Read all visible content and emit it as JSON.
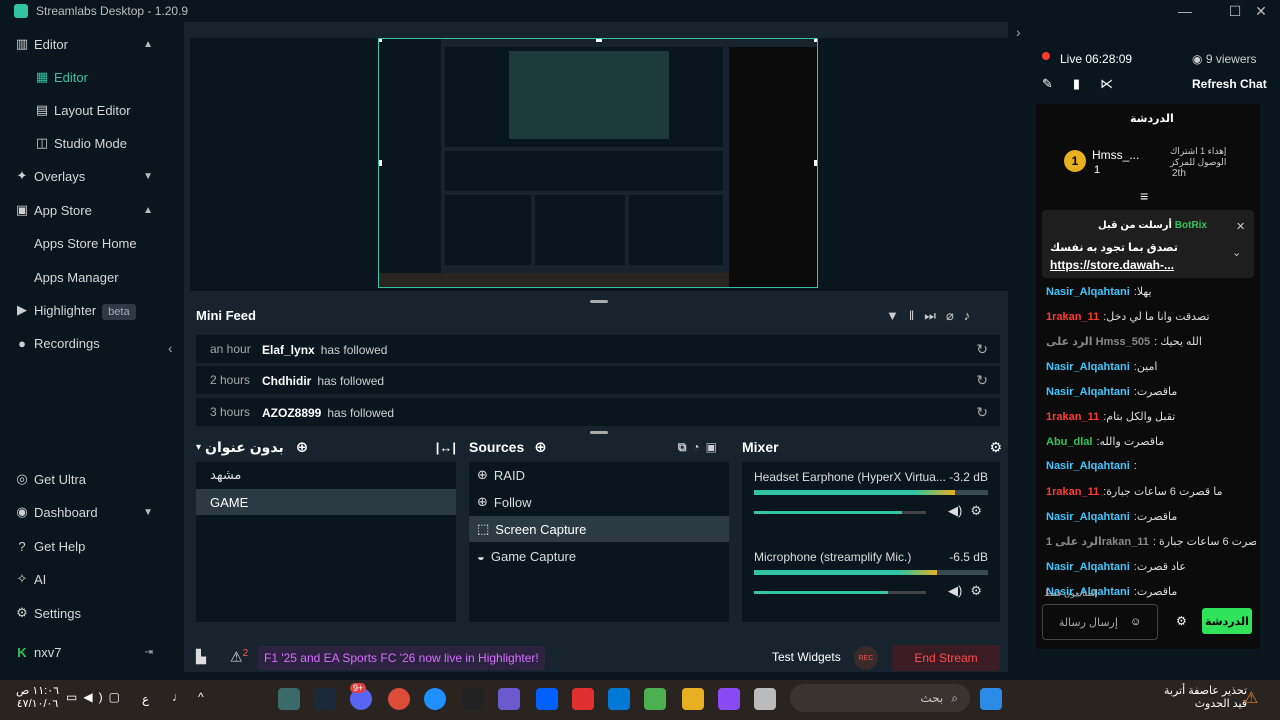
{
  "titlebar": {
    "title": "Streamlabs Desktop - 1.20.9"
  },
  "sidebar": {
    "items": [
      {
        "label": "Editor",
        "icon": "layout-icon",
        "chevron": "▲"
      },
      {
        "label": "Editor",
        "icon": "editor-icon"
      },
      {
        "label": "Layout Editor",
        "icon": "grid-icon"
      },
      {
        "label": "Studio Mode",
        "icon": "studio-icon"
      },
      {
        "label": "Overlays",
        "icon": "overlays-icon",
        "chevron": "▼"
      },
      {
        "label": "App Store",
        "icon": "store-icon",
        "chevron": "▲"
      },
      {
        "label": "Apps Store Home"
      },
      {
        "label": "Apps Manager"
      },
      {
        "label": "Highlighter",
        "icon": "highlighter-icon",
        "badge": "beta"
      },
      {
        "label": "Recordings",
        "icon": "recordings-icon"
      }
    ],
    "bottom": [
      {
        "label": "Get Ultra",
        "icon": "ultra-icon"
      },
      {
        "label": "Dashboard",
        "icon": "dashboard-icon",
        "chevron": "▼"
      },
      {
        "label": "Get Help",
        "icon": "help-icon"
      },
      {
        "label": "AI",
        "icon": "ai-icon"
      },
      {
        "label": "Settings",
        "icon": "gear-icon"
      }
    ],
    "user": "nxv7"
  },
  "minifeed": {
    "title": "Mini Feed",
    "rows": [
      {
        "time": "an hour",
        "who": "Elaf_lynx",
        "action": "has followed"
      },
      {
        "time": "2 hours",
        "who": "Chdhidir",
        "action": "has followed"
      },
      {
        "time": "3 hours",
        "who": "AZOZ8899",
        "action": "has followed"
      }
    ]
  },
  "scenes": {
    "title": "بدون عنوان",
    "items": [
      "مشهد",
      "GAME"
    ]
  },
  "sources": {
    "title": "Sources",
    "items": [
      "RAID",
      "Follow",
      "Screen Capture",
      "Game Capture"
    ]
  },
  "mixer": {
    "title": "Mixer",
    "channels": [
      {
        "name": "Headset Earphone (HyperX Virtua...",
        "db": "-3.2 dB",
        "level": 0.86
      },
      {
        "name": "Microphone (streamplify Mic.)",
        "db": "-6.5 dB",
        "level": 0.78
      }
    ]
  },
  "footer": {
    "alerts": "2",
    "promo": "F1 '25 and EA Sports FC '26 now live in Highlighter!",
    "test_widgets": "Test Widgets",
    "rec": "REC",
    "end_stream": "End Stream"
  },
  "chat": {
    "live": "Live",
    "time": "06:28:09",
    "viewers": "9 viewers",
    "refresh": "Refresh Chat",
    "header": "الدردشة",
    "top_user": "Hmss_...",
    "top_count": "1",
    "gift_text": "إهداء 1 اشتراك الوصول للمركز",
    "gift_rank": "2th",
    "pinned_from": "أرسلت من قبل",
    "pinned_user": "BotRix",
    "pinned_msg": "تصدق بما تجود به نفسك",
    "pinned_link": "https://store.dawah-...",
    "messages": [
      {
        "user": "Nasir_Alqahtani",
        "text": ":يهلا",
        "color": "#41c6ff"
      },
      {
        "user": "1rakan_11",
        "text": ":تصدقت وانا ما لي دخل",
        "color": "#ff3b30"
      },
      {
        "user": "الرد على Hmss_505",
        "text": ": الله يحيك",
        "color": "#888"
      },
      {
        "user": "Nasir_Alqahtani",
        "text": ":امين",
        "color": "#41c6ff"
      },
      {
        "user": "Nasir_Alqahtani",
        "text": ":ماقصرت",
        "color": "#41c6ff"
      },
      {
        "user": "1rakan_11",
        "text": ":تقبل والكل بتام",
        "color": "#ff3b30"
      },
      {
        "user": "Abu_dlal",
        "text": ":ماقصرت والله",
        "color": "#31c35a"
      },
      {
        "user": "Nasir_Alqahtani",
        "text": ":",
        "color": "#41c6ff"
      },
      {
        "user": "1rakan_11",
        "text": ":ما قصرت 6 ساعات جبارة",
        "color": "#ff3b30"
      },
      {
        "user": "Nasir_Alqahtani",
        "text": ":ماقصرت",
        "color": "#41c6ff"
      },
      {
        "user": "الرد على 1rakan_11",
        "text": ": ما قصرت 6 ساعات جبارة",
        "color": "#888"
      },
      {
        "user": "Nasir_Alqahtani",
        "text": ":عاد قصرت",
        "color": "#41c6ff"
      },
      {
        "user": "Nasir_Alqahtani",
        "text": ":ماقصرت",
        "color": "#41c6ff"
      }
    ],
    "followers_only": "المتابعون فقط",
    "input_placeholder": "إرسال رسالة",
    "send": "الدردشة"
  },
  "taskbar": {
    "time": "١١:٠٦ ص",
    "date": "٤٧/١٠/٠٦",
    "lang": "ع",
    "search": "بحث",
    "weather_title": "تحذير عاصفة أتربة",
    "weather_sub": "قيد الحدوث",
    "discord_badge": "9+"
  }
}
